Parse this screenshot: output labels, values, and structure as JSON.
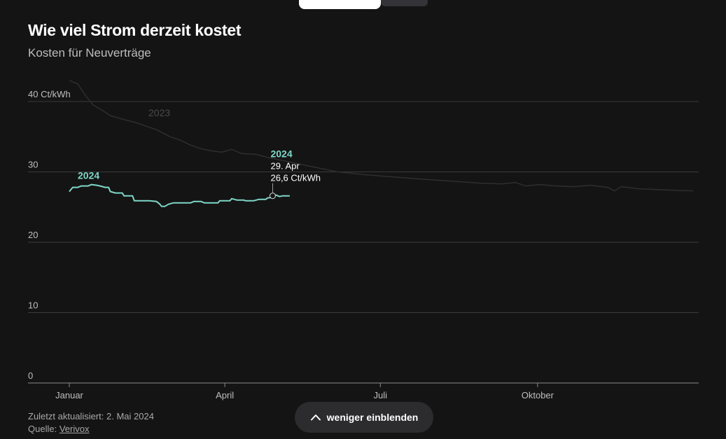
{
  "header": {
    "title": "Wie viel Strom derzeit kostet",
    "subtitle": "Kosten für Neuverträge"
  },
  "footer": {
    "updated_label": "Zuletzt aktualisiert: 2. Mai 2024",
    "source_prefix": "Quelle: ",
    "source_link": "Verivox"
  },
  "toggle_button": {
    "label": "weniger einblenden",
    "icon": "chevron-up-icon"
  },
  "colors": {
    "background": "#141414",
    "series_2024": "#7fd6c8",
    "series_2023": "#2e2e2e",
    "grid": "#3a3a3a",
    "axis": "#8a8a8a",
    "text": "#e8e8e8"
  },
  "chart_data": {
    "type": "line",
    "title": "Wie viel Strom derzeit kostet",
    "subtitle": "Kosten für Neuverträge",
    "ylabel": "",
    "y_unit_label": "Ct/kWh",
    "ylim": [
      0,
      40
    ],
    "yticks": [
      {
        "value": 0,
        "label": "0"
      },
      {
        "value": 10,
        "label": "10"
      },
      {
        "value": 20,
        "label": "20"
      },
      {
        "value": 30,
        "label": "30"
      },
      {
        "value": 40,
        "label": "40 Ct/kWh"
      }
    ],
    "xlim": [
      1,
      366
    ],
    "xticks": [
      {
        "day": 1,
        "label": "Januar"
      },
      {
        "day": 92,
        "label": "April"
      },
      {
        "day": 183,
        "label": "Juli"
      },
      {
        "day": 275,
        "label": "Oktober"
      }
    ],
    "grid": true,
    "series": [
      {
        "name": "2024",
        "label_position": "start",
        "points": [
          [
            1,
            27.2
          ],
          [
            2,
            27.5
          ],
          [
            3,
            27.8
          ],
          [
            6,
            27.8
          ],
          [
            8,
            28.0
          ],
          [
            12,
            28.0
          ],
          [
            14,
            28.2
          ],
          [
            17,
            28.1
          ],
          [
            19,
            28.0
          ],
          [
            22,
            27.8
          ],
          [
            24,
            27.8
          ],
          [
            25,
            27.2
          ],
          [
            28,
            27.0
          ],
          [
            32,
            27.0
          ],
          [
            33,
            26.6
          ],
          [
            38,
            26.6
          ],
          [
            39,
            25.9
          ],
          [
            43,
            25.9
          ],
          [
            48,
            25.9
          ],
          [
            52,
            25.8
          ],
          [
            54,
            25.4
          ],
          [
            55,
            25.1
          ],
          [
            57,
            25.1
          ],
          [
            59,
            25.4
          ],
          [
            62,
            25.6
          ],
          [
            66,
            25.6
          ],
          [
            72,
            25.6
          ],
          [
            74,
            25.8
          ],
          [
            78,
            25.8
          ],
          [
            80,
            25.6
          ],
          [
            88,
            25.6
          ],
          [
            89,
            25.9
          ],
          [
            92,
            25.9
          ],
          [
            95,
            25.9
          ],
          [
            96,
            26.2
          ],
          [
            99,
            26.0
          ],
          [
            103,
            26.0
          ],
          [
            104,
            25.9
          ],
          [
            109,
            25.9
          ],
          [
            112,
            26.1
          ],
          [
            116,
            26.1
          ],
          [
            117,
            26.3
          ],
          [
            120,
            26.4
          ],
          [
            122,
            26.7
          ],
          [
            124,
            26.5
          ],
          [
            126,
            26.6
          ],
          [
            130,
            26.6
          ]
        ]
      },
      {
        "name": "2023",
        "label_position": "top-left",
        "points": [
          [
            1,
            44.0
          ],
          [
            6,
            42.5
          ],
          [
            10,
            41.0
          ],
          [
            15,
            39.5
          ],
          [
            20,
            38.8
          ],
          [
            25,
            38.0
          ],
          [
            32,
            37.5
          ],
          [
            40,
            37.0
          ],
          [
            46,
            36.5
          ],
          [
            52,
            36.0
          ],
          [
            60,
            35.0
          ],
          [
            66,
            34.5
          ],
          [
            72,
            33.8
          ],
          [
            78,
            33.3
          ],
          [
            84,
            33.0
          ],
          [
            90,
            32.8
          ],
          [
            96,
            33.2
          ],
          [
            102,
            32.6
          ],
          [
            110,
            32.5
          ],
          [
            118,
            32.0
          ],
          [
            126,
            31.6
          ],
          [
            134,
            31.2
          ],
          [
            142,
            30.8
          ],
          [
            150,
            30.4
          ],
          [
            158,
            30.0
          ],
          [
            166,
            29.8
          ],
          [
            174,
            29.6
          ],
          [
            184,
            29.4
          ],
          [
            195,
            29.2
          ],
          [
            206,
            29.0
          ],
          [
            218,
            28.8
          ],
          [
            230,
            28.6
          ],
          [
            242,
            28.4
          ],
          [
            254,
            28.3
          ],
          [
            262,
            28.5
          ],
          [
            268,
            28.0
          ],
          [
            276,
            28.2
          ],
          [
            286,
            28.0
          ],
          [
            296,
            27.9
          ],
          [
            306,
            28.1
          ],
          [
            316,
            27.8
          ],
          [
            320,
            27.3
          ],
          [
            324,
            27.9
          ],
          [
            334,
            27.6
          ],
          [
            344,
            27.5
          ],
          [
            354,
            27.4
          ],
          [
            366,
            27.3
          ]
        ]
      }
    ],
    "tooltip": {
      "series": "2024",
      "date_label": "29. Apr",
      "value_label": "26,6 Ct/kWh",
      "day": 120,
      "value": 26.6
    }
  }
}
